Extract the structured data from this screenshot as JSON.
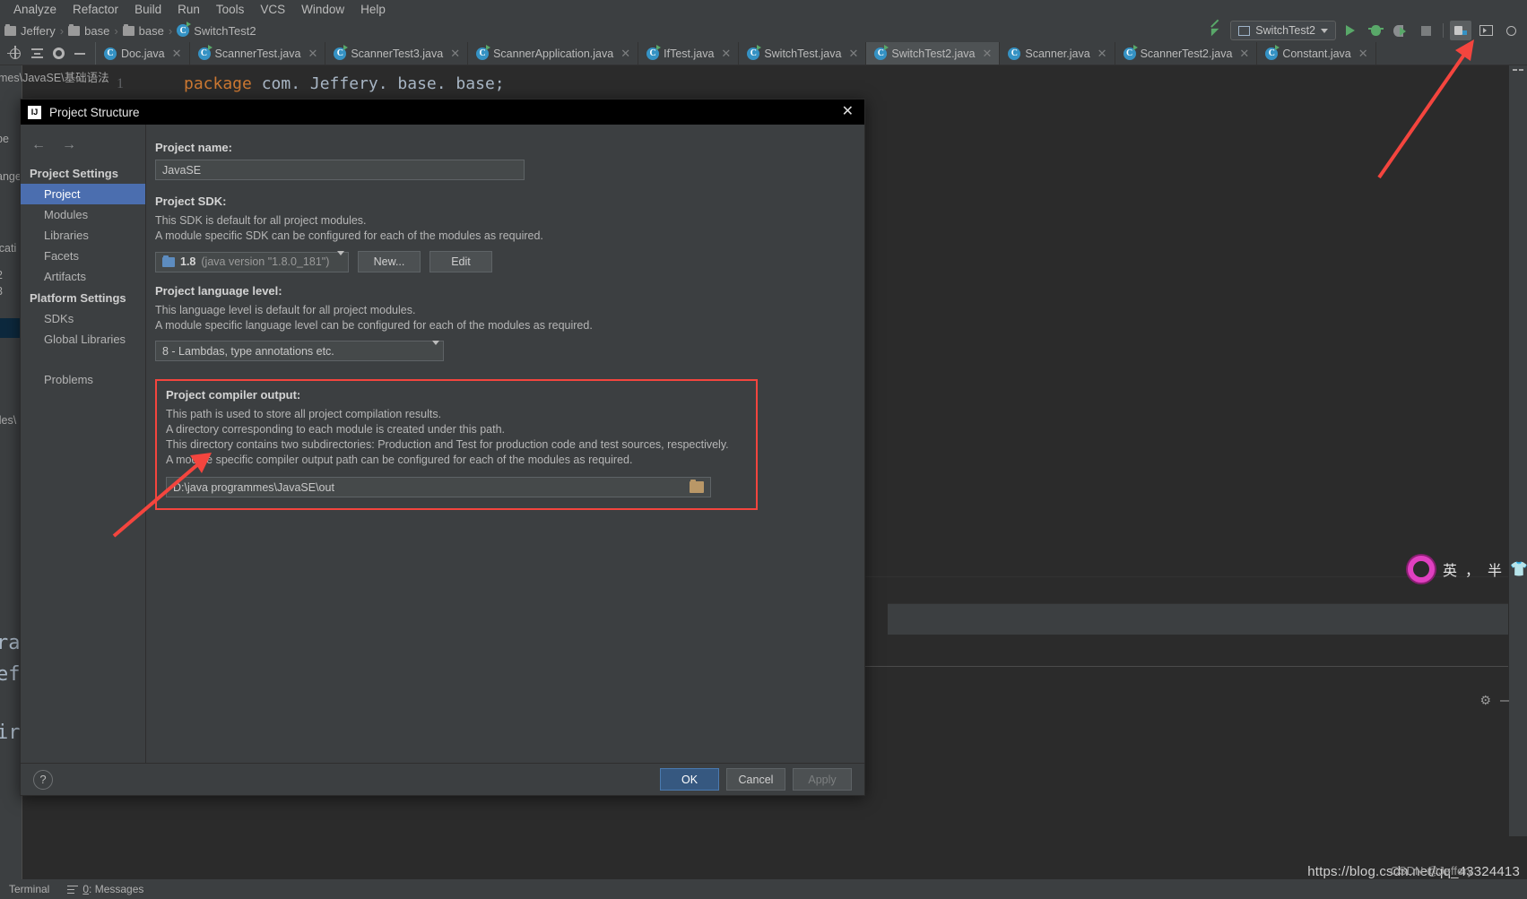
{
  "app": {
    "menu": [
      "Analyze",
      "Refactor",
      "Build",
      "Run",
      "Tools",
      "VCS",
      "Window",
      "Help"
    ]
  },
  "breadcrumb": {
    "items": [
      {
        "label": "Jeffery",
        "icon": "folder-icon"
      },
      {
        "label": "base",
        "icon": "folder-icon"
      },
      {
        "label": "base",
        "icon": "folder-icon"
      },
      {
        "label": "SwitchTest2",
        "icon": "java-class-run-icon"
      }
    ],
    "separator": "›"
  },
  "toolbar": {
    "run_configuration": "SwitchTest2",
    "icons": [
      "jump-to-source-icon",
      "run-icon",
      "debug-icon",
      "run-coverage-icon",
      "stop-icon",
      "project-structure-icon",
      "terminal-icon",
      "search-icon"
    ]
  },
  "tabs": {
    "tool_icons": [
      "locate-icon",
      "collapse-all-icon",
      "settings-icon",
      "hide-icon"
    ],
    "items": [
      {
        "label": "Doc.java",
        "icon": "java-class-icon",
        "active": false
      },
      {
        "label": "ScannerTest.java",
        "icon": "java-class-run-icon",
        "active": false
      },
      {
        "label": "ScannerTest3.java",
        "icon": "java-class-run-icon",
        "active": false
      },
      {
        "label": "ScannerApplication.java",
        "icon": "java-class-run-icon",
        "active": false
      },
      {
        "label": "IfTest.java",
        "icon": "java-class-run-icon",
        "active": false
      },
      {
        "label": "SwitchTest.java",
        "icon": "java-class-run-icon",
        "active": false
      },
      {
        "label": "SwitchTest2.java",
        "icon": "java-class-run-icon",
        "active": true
      },
      {
        "label": "Scanner.java",
        "icon": "java-class-readonly-icon",
        "active": false
      },
      {
        "label": "ScannerTest2.java",
        "icon": "java-class-run-icon",
        "active": false
      },
      {
        "label": "Constant.java",
        "icon": "java-class-run-icon",
        "active": false
      }
    ],
    "close_glyph": "✕"
  },
  "editor": {
    "line_number": "1",
    "code_keyword": "package",
    "code_rest": " com. Jeffery. base. base;",
    "project_path_fragment": "mes\\JavaSE\\基础语法",
    "left_fragments": [
      "be",
      "ange",
      "icati",
      "2",
      "3",
      "iles\\"
    ],
    "left_big_words": [
      "ran",
      "ef",
      "ir"
    ]
  },
  "ime": {
    "mode_label": "英",
    "punct_label": "，",
    "width_label": "半",
    "extra_glyph": "👕"
  },
  "dialog": {
    "title": "Project Structure",
    "close_glyph": "✕",
    "nav_back": "←",
    "nav_forward": "→",
    "sidebar": {
      "sections": [
        {
          "header": "Project Settings",
          "items": [
            {
              "label": "Project",
              "selected": true
            },
            {
              "label": "Modules",
              "selected": false
            },
            {
              "label": "Libraries",
              "selected": false
            },
            {
              "label": "Facets",
              "selected": false
            },
            {
              "label": "Artifacts",
              "selected": false
            }
          ]
        },
        {
          "header": "Platform Settings",
          "items": [
            {
              "label": "SDKs",
              "selected": false
            },
            {
              "label": "Global Libraries",
              "selected": false
            }
          ]
        }
      ],
      "problems_label": "Problems"
    },
    "project_name": {
      "label": "Project name:",
      "value": "JavaSE"
    },
    "project_sdk": {
      "label": "Project SDK:",
      "desc_line1": "This SDK is default for all project modules.",
      "desc_line2": "A module specific SDK can be configured for each of the modules as required.",
      "value_bold": "1.8",
      "value_rest": "(java version \"1.8.0_181\")",
      "new_button": "New...",
      "edit_button": "Edit"
    },
    "language_level": {
      "label": "Project language level:",
      "desc_line1": "This language level is default for all project modules.",
      "desc_line2": "A module specific language level can be configured for each of the modules as required.",
      "value": "8 - Lambdas, type annotations etc."
    },
    "compiler_output": {
      "label": "Project compiler output:",
      "desc_line1": "This path is used to store all project compilation results.",
      "desc_line2": "A directory corresponding to each module is created under this path.",
      "desc_line3": "This directory contains two subdirectories: Production and Test for production code and test sources, respectively.",
      "desc_line4": "A module specific compiler output path can be configured for each of the modules as required.",
      "path_value": "D:\\java programmes\\JavaSE\\out",
      "highlight_color": "#f4453e"
    },
    "footer": {
      "help": "?",
      "ok": "OK",
      "cancel": "Cancel",
      "apply": "Apply"
    }
  },
  "statusbar": {
    "terminal": "Terminal",
    "messages_prefix": "0",
    "messages_label": ": Messages",
    "watermark": "https://blog.csdn.net/qq_43324413",
    "watermark_sub": "CSDN @Jeffery"
  },
  "colors": {
    "accent_blue": "#4b6eaf",
    "primary_button": "#365880",
    "annotation_red": "#f4453e",
    "keyword_orange": "#cc7832",
    "editor_bg": "#2b2b2b",
    "chrome_bg": "#3c3f41"
  }
}
